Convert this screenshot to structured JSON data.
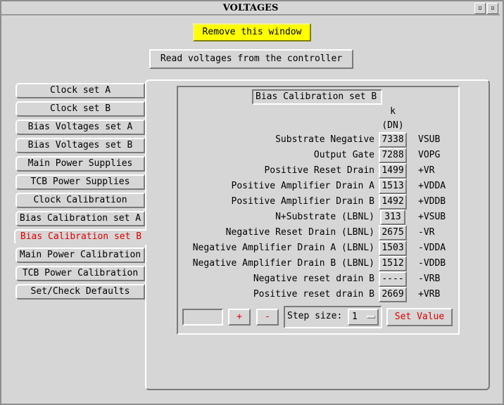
{
  "window": {
    "title": "VOLTAGES",
    "btn_iconify": "▫",
    "btn_close": "▫"
  },
  "toolbar": {
    "remove_label": "Remove this window",
    "read_label": "Read voltages from the controller"
  },
  "sidebar": {
    "items": [
      {
        "label": "Clock set A"
      },
      {
        "label": "Clock set B"
      },
      {
        "label": "Bias Voltages set A"
      },
      {
        "label": "Bias Voltages set B"
      },
      {
        "label": "Main Power Supplies"
      },
      {
        "label": "TCB Power Supplies"
      },
      {
        "label": "Clock Calibration"
      },
      {
        "label": "Bias Calibration set A"
      },
      {
        "label": "Bias Calibration set B"
      },
      {
        "label": "Main Power Calibration"
      },
      {
        "label": "TCB Power Calibration"
      },
      {
        "label": "Set/Check Defaults"
      }
    ],
    "active_index": 8
  },
  "panel": {
    "title": "Bias Calibration set B",
    "unit_line1": "k",
    "unit_line2": "(DN)",
    "rows": [
      {
        "label": "Substrate Negative",
        "value": "7338",
        "code": "VSUB"
      },
      {
        "label": "Output Gate",
        "value": "7288",
        "code": "VOPG"
      },
      {
        "label": "Positive Reset Drain",
        "value": "1499",
        "code": "+VR"
      },
      {
        "label": "Positive Amplifier Drain A",
        "value": "1513",
        "code": "+VDDA"
      },
      {
        "label": "Positive Amplifier Drain B",
        "value": "1492",
        "code": "+VDDB"
      },
      {
        "label": "N+Substrate (LBNL)",
        "value": "313",
        "code": "+VSUB"
      },
      {
        "label": "Negative Reset Drain (LBNL)",
        "value": "2675",
        "code": "-VR"
      },
      {
        "label": "Negative Amplifier Drain A (LBNL)",
        "value": "1503",
        "code": "-VDDA"
      },
      {
        "label": "Negative Amplifier Drain B (LBNL)",
        "value": "1512",
        "code": "-VDDB"
      },
      {
        "label": "Negative reset drain B",
        "value": "----",
        "code": "-VRB"
      },
      {
        "label": "Positive reset drain B",
        "value": "2669",
        "code": "+VRB"
      }
    ],
    "entry_value": "",
    "plus_label": "+",
    "minus_label": "-",
    "step_label": "Step size:",
    "step_value": "1",
    "set_label": "Set Value"
  },
  "colors": {
    "accent_red": "#e00000",
    "remove_yellow": "#ffff00",
    "background": "#d6d6d6"
  }
}
